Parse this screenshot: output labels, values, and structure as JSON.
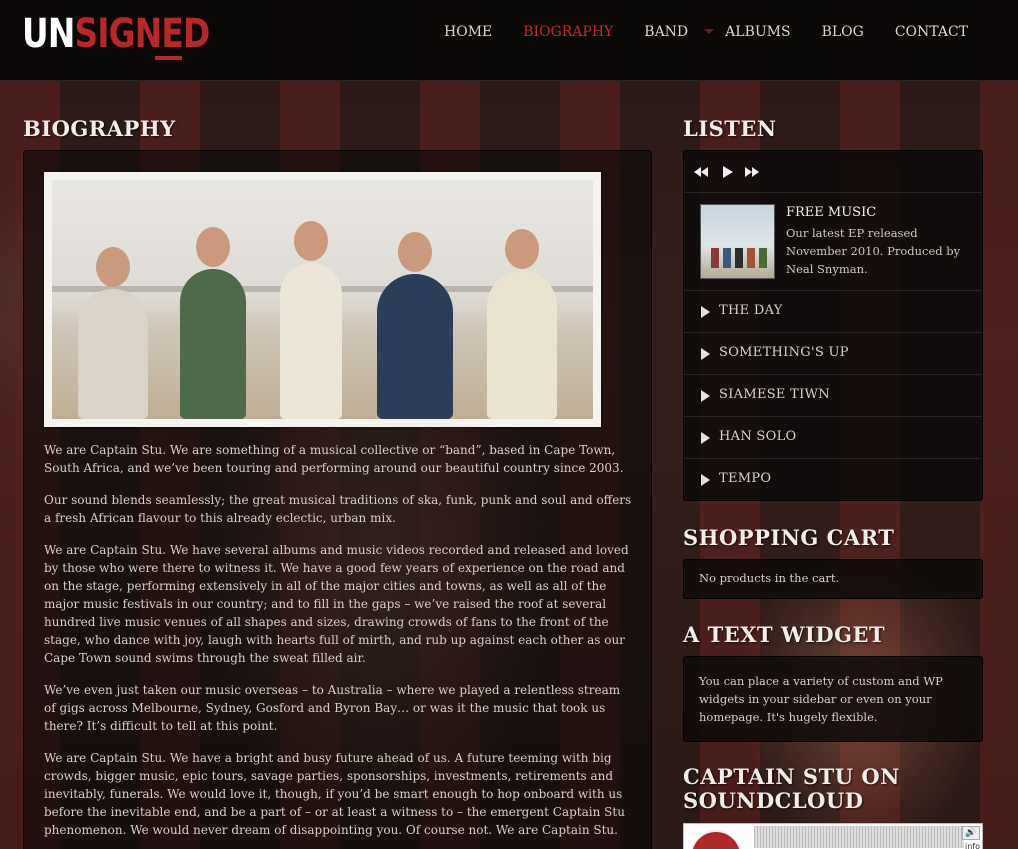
{
  "logo": {
    "part1": "UN",
    "part2": "SIGNED"
  },
  "nav": {
    "items": [
      {
        "label": "HOME"
      },
      {
        "label": "BIOGRAPHY"
      },
      {
        "label": "BAND"
      },
      {
        "label": "ALBUMS"
      },
      {
        "label": "BLOG"
      },
      {
        "label": "CONTACT"
      }
    ],
    "active": "BIOGRAPHY"
  },
  "main": {
    "title": "BIOGRAPHY",
    "paragraphs": [
      "We are Captain Stu. We are something of a musical collective or “band”, based in Cape Town, South Africa, and we’ve been touring and performing around our beautiful country since 2003.",
      "Our sound blends seamlessly; the great musical traditions of ska, funk, punk and soul and offers a fresh African flavour to this already eclectic, urban mix.",
      "We are Captain Stu. We have several albums and music videos recorded and released and loved by those who were there to witness it. We have a good few years of experience on the road and on the stage, performing extensively in all of the major cities and towns, as well as all of the major music festivals in our country; and to fill in the gaps – we’ve raised the roof at several hundred live music venues of all shapes and sizes, drawing crowds of fans to the front of the stage, who dance with joy, laugh with hearts full of mirth, and rub up against each other as our Cape Town sound swims through the sweat filled air.",
      "We’ve even just taken our music overseas – to Australia – where we played a relentless stream of gigs across Melbourne, Sydney, Gosford and Byron Bay… or was it the music that took us there? It’s difficult to tell at this point.",
      "We are Captain Stu. We have a bright and busy future ahead of us. A future teeming with big crowds, bigger music, epic tours, savage parties, sponsorships, investments, retirements and inevitably, funerals. We would love it, though, if you’d be smart enough to hop onboard with us before the inevitable end, and be a part of – or at least a witness to – the emergent Captain Stu phenomenon. We would never dream of disappointing you. Of course not. We are Captain Stu."
    ]
  },
  "sidebar": {
    "listen": {
      "title": "LISTEN",
      "album_title": "FREE MUSIC",
      "album_desc": "Our latest EP released November 2010. Produced by Neal Snyman.",
      "tracks": [
        {
          "name": "THE DAY"
        },
        {
          "name": "SOMETHING'S UP"
        },
        {
          "name": "SIAMESE TIWN"
        },
        {
          "name": "HAN SOLO"
        },
        {
          "name": "TEMPO"
        }
      ]
    },
    "cart": {
      "title": "SHOPPING CART",
      "text": "No products in the cart."
    },
    "text_widget": {
      "title": "A TEXT WIDGET",
      "text": "You can place a variety of custom and WP widgets in your sidebar or even on your homepage. It's hugely flexible."
    },
    "soundcloud": {
      "title": "CAPTAIN STU ON SOUNDCLOUD",
      "info": "info"
    }
  },
  "colors": {
    "accent": "#b92727",
    "text": "#d2c8c2"
  },
  "icons": {
    "prev": "previous-track-icon",
    "play": "play-icon",
    "next": "next-track-icon"
  }
}
